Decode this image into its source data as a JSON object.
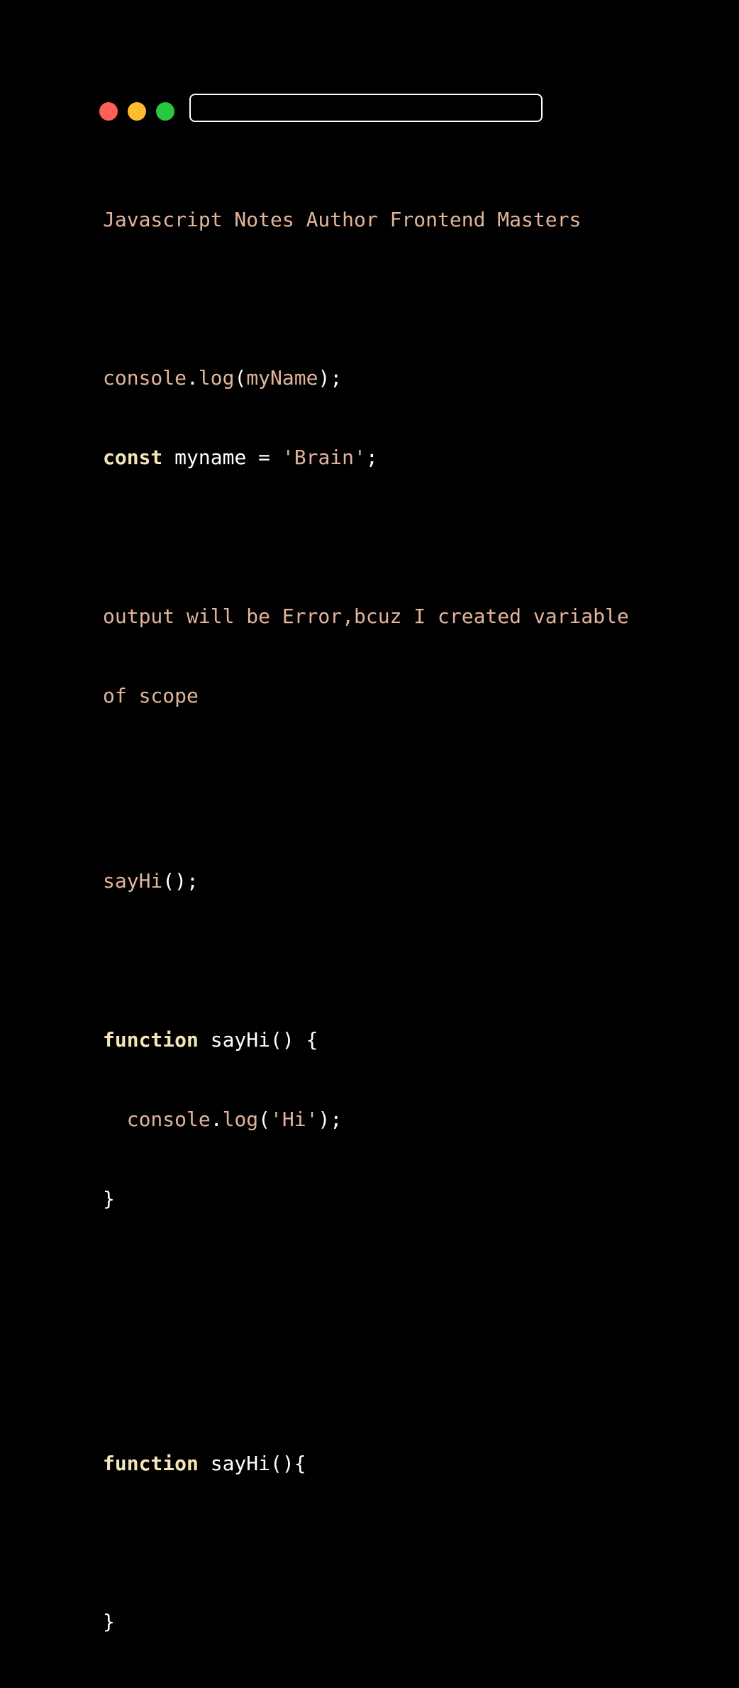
{
  "window": {
    "controls": {
      "close_color": "#ff5f57",
      "minimize_color": "#febc2e",
      "maximize_color": "#28c840"
    },
    "address_bar": ""
  },
  "code": {
    "title_line": "Javascript Notes Author Frontend Masters",
    "l1": {
      "a": "console",
      "b": ".",
      "c": "log",
      "d": "(",
      "e": "myName",
      "f": ");"
    },
    "l2": {
      "kw": "const",
      "rest": " myname = ",
      "str": "'Brain'",
      "end": ";"
    },
    "note_line1": "output will be Error,bcuz I created variable",
    "note_line2": "of scope",
    "l3": {
      "fn": "sayHi",
      "end": "();"
    },
    "l4": {
      "kw": "function",
      "rest": " sayHi() {"
    },
    "l5": {
      "indent": "  ",
      "a": "console",
      "b": ".",
      "c": "log",
      "d": "(",
      "str": "'Hi'",
      "end": ");"
    },
    "l6": "}",
    "l7": {
      "kw": "function",
      "rest": " sayHi(){"
    },
    "l8": "}"
  }
}
